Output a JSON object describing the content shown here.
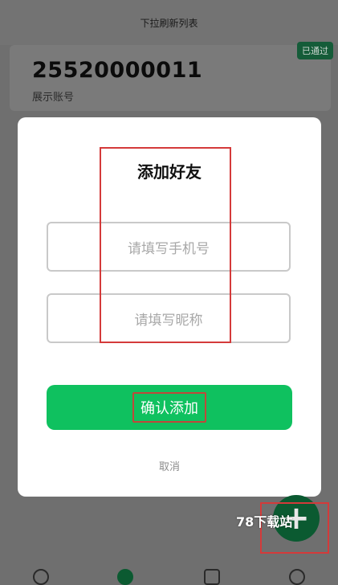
{
  "page": {
    "title": "下拉刷新列表"
  },
  "account": {
    "number": "25520000011",
    "label": "展示账号",
    "status_badge": "已通过"
  },
  "dialog": {
    "title": "添加好友",
    "phone_placeholder": "请填写手机号",
    "nickname_placeholder": "请填写昵称",
    "confirm_label": "确认添加",
    "cancel_label": "取消"
  },
  "fab": {
    "symbol": "+"
  },
  "watermark": "78下载站",
  "colors": {
    "primary_green": "#0fc15f",
    "annotation_red": "#d43a3a"
  }
}
